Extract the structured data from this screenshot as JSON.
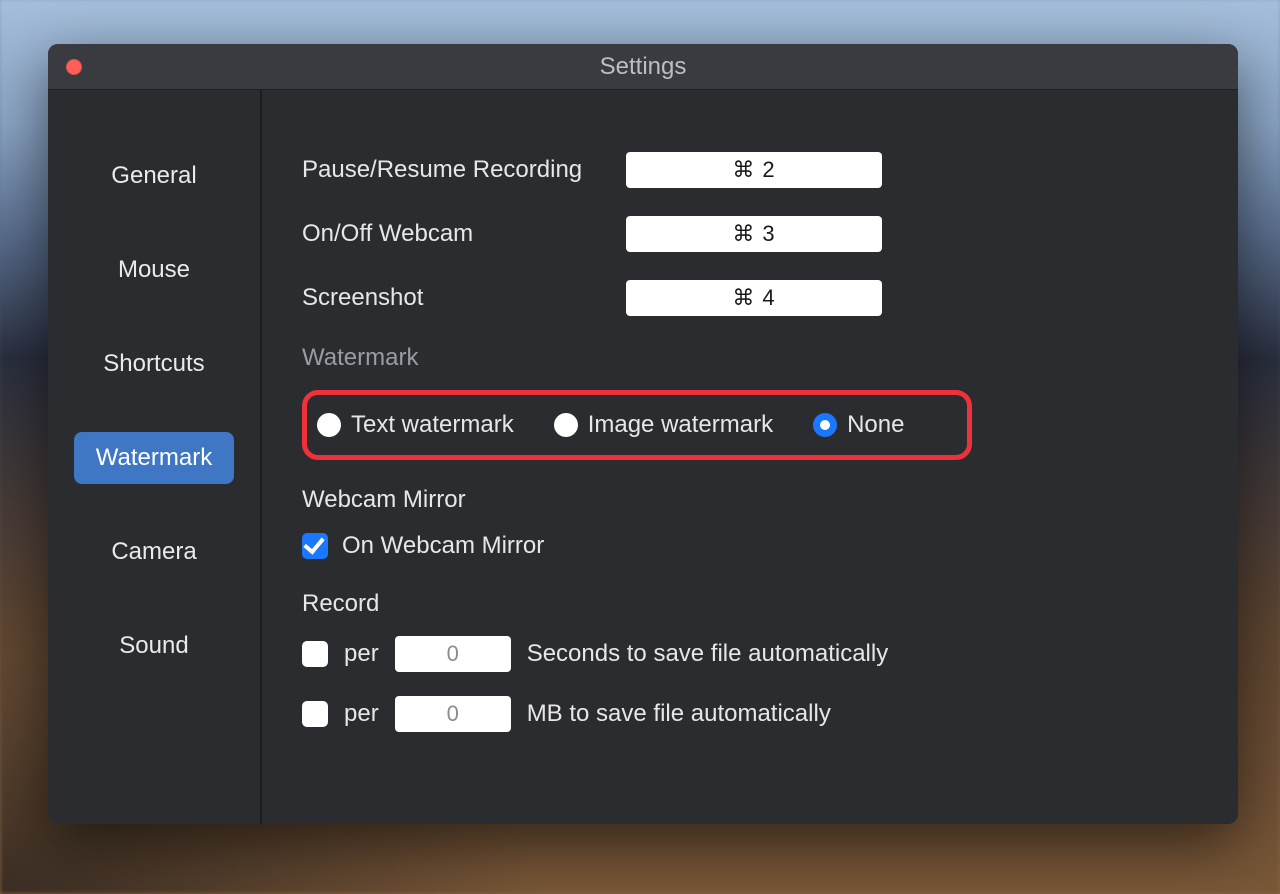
{
  "window": {
    "title": "Settings"
  },
  "sidebar": {
    "items": [
      {
        "label": "General"
      },
      {
        "label": "Mouse"
      },
      {
        "label": "Shortcuts"
      },
      {
        "label": "Watermark",
        "selected": true
      },
      {
        "label": "Camera"
      },
      {
        "label": "Sound"
      }
    ]
  },
  "shortcuts": {
    "pause_resume": {
      "label": "Pause/Resume Recording",
      "value": "⌘ 2"
    },
    "webcam_toggle": {
      "label": "On/Off Webcam",
      "value": "⌘ 3"
    },
    "screenshot": {
      "label": "Screenshot",
      "value": "⌘ 4"
    }
  },
  "watermark": {
    "section_title": "Watermark",
    "options": {
      "text": {
        "label": "Text watermark",
        "selected": false
      },
      "image": {
        "label": "Image watermark",
        "selected": false
      },
      "none": {
        "label": "None",
        "selected": true
      }
    }
  },
  "webcam_mirror": {
    "section_title": "Webcam Mirror",
    "checkbox_label": "On Webcam Mirror",
    "enabled": true
  },
  "record": {
    "section_title": "Record",
    "per_label": "per",
    "seconds": {
      "enabled": false,
      "value": "0",
      "suffix": "Seconds to save file automatically"
    },
    "mb": {
      "enabled": false,
      "value": "0",
      "suffix": "MB to save file automatically"
    }
  }
}
